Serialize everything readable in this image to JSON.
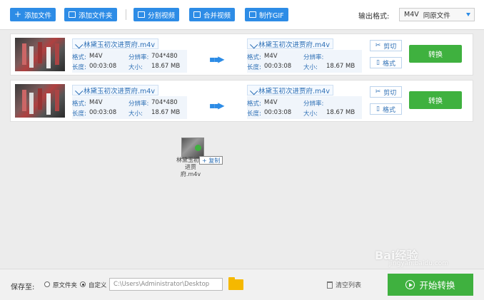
{
  "toolbar": {
    "add_file": "添加文件",
    "add_folder": "添加文件夹",
    "split_video": "分割视频",
    "merge_video": "合并视频",
    "make_gif": "制作GIF",
    "output_format_label": "输出格式:",
    "output_format_value": "M4V",
    "output_format_note": "同原文件"
  },
  "rows": [
    {
      "src_name": "林黛玉初次进贾府.m4v",
      "src_format_label": "格式:",
      "src_format": "M4V",
      "src_res_label": "分辨率:",
      "src_res": "704*480",
      "src_dur_label": "长度:",
      "src_dur": "00:03:08",
      "src_size_label": "大小:",
      "src_size": "18.67 MB",
      "dst_name": "林黛玉初次进贾府.m4v",
      "dst_format_label": "格式:",
      "dst_format": "M4V",
      "dst_res_label": "分辨率:",
      "dst_res": "",
      "dst_dur_label": "长度:",
      "dst_dur": "00:03:08",
      "dst_size_label": "大小:",
      "dst_size": "18.67 MB",
      "cut_label": "剪切",
      "format_label": "格式",
      "convert_label": "转换"
    },
    {
      "src_name": "林黛玉初次进贾府.m4v",
      "src_format_label": "格式:",
      "src_format": "M4V",
      "src_res_label": "分辨率:",
      "src_res": "704*480",
      "src_dur_label": "长度:",
      "src_dur": "00:03:08",
      "src_size_label": "大小:",
      "src_size": "18.67 MB",
      "dst_name": "林黛玉初次进贾府.m4v",
      "dst_format_label": "格式:",
      "dst_format": "M4V",
      "dst_res_label": "分辨率:",
      "dst_res": "",
      "dst_dur_label": "长度:",
      "dst_dur": "00:03:08",
      "dst_size_label": "大小:",
      "dst_size": "18.67 MB",
      "cut_label": "剪切",
      "format_label": "格式",
      "convert_label": "转换"
    }
  ],
  "drag": {
    "file_name": "林黛玉初次进贾府.m4v",
    "copy_label": "+ 复制"
  },
  "bottom": {
    "save_to": "保存至:",
    "original_folder": "原文件夹",
    "custom": "自定义",
    "path": "C:\\Users\\Administrator\\Desktop",
    "clear_list": "清空列表",
    "start_convert": "开始转换"
  },
  "watermark": {
    "brand": "Bai经验",
    "url": "jingyan.baidu.com"
  }
}
